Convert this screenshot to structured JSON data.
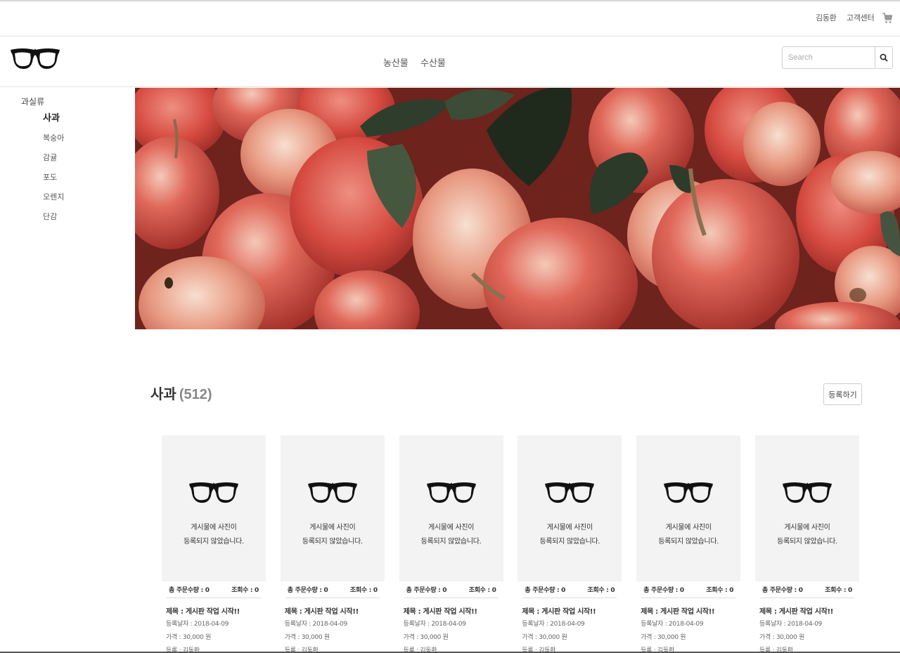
{
  "util_bar": {
    "user_name": "김동환",
    "customer_center": "고객센터",
    "cart_icon": "cart-icon"
  },
  "header": {
    "logo_icon": "glasses-logo-icon",
    "nav": [
      "농산물",
      "수산물"
    ],
    "search": {
      "placeholder": "Search",
      "value": "",
      "button_icon": "search-icon"
    }
  },
  "sidebar": {
    "category": "과실류",
    "items": [
      {
        "label": "사과",
        "active": true
      },
      {
        "label": "복숭아",
        "active": false
      },
      {
        "label": "감귤",
        "active": false
      },
      {
        "label": "포도",
        "active": false
      },
      {
        "label": "오렌지",
        "active": false
      },
      {
        "label": "단감",
        "active": false
      }
    ]
  },
  "banner": {
    "content": "apples-photo"
  },
  "section": {
    "title": "사과",
    "count": "(512)",
    "register_button": "등록하기"
  },
  "products": [
    {
      "msg_line1": "게시물에 사진이",
      "msg_line2": "등록되지 않았습니다.",
      "orders": "총 주문수량 : 0",
      "views": "조회수 : 0",
      "title": "제목 : 게시판 작업 시작!!",
      "date": "등록날자 : 2018-04-09",
      "price": "가격 : 30,000 원",
      "author": "등록 : 김동환"
    },
    {
      "msg_line1": "게시물에 사진이",
      "msg_line2": "등록되지 않았습니다.",
      "orders": "총 주문수량 : 0",
      "views": "조회수 : 0",
      "title": "제목 : 게시판 작업 시작!!",
      "date": "등록날자 : 2018-04-09",
      "price": "가격 : 30,000 원",
      "author": "등록 : 김동환"
    },
    {
      "msg_line1": "게시물에 사진이",
      "msg_line2": "등록되지 않았습니다.",
      "orders": "총 주문수량 : 0",
      "views": "조회수 : 0",
      "title": "제목 : 게시판 작업 시작!!",
      "date": "등록날자 : 2018-04-09",
      "price": "가격 : 30,000 원",
      "author": "등록 : 김동환"
    },
    {
      "msg_line1": "게시물에 사진이",
      "msg_line2": "등록되지 않았습니다.",
      "orders": "총 주문수량 : 0",
      "views": "조회수 : 0",
      "title": "제목 : 게시판 작업 시작!!",
      "date": "등록날자 : 2018-04-09",
      "price": "가격 : 30,000 원",
      "author": "등록 : 김동환"
    },
    {
      "msg_line1": "게시물에 사진이",
      "msg_line2": "등록되지 않았습니다.",
      "orders": "총 주문수량 : 0",
      "views": "조회수 : 0",
      "title": "제목 : 게시판 작업 시작!!",
      "date": "등록날자 : 2018-04-09",
      "price": "가격 : 30,000 원",
      "author": "등록 : 김동환"
    },
    {
      "msg_line1": "게시물에 사진이",
      "msg_line2": "등록되지 않았습니다.",
      "orders": "총 주문수량 : 0",
      "views": "조회수 : 0",
      "title": "제목 : 게시판 작업 시작!!",
      "date": "등록날자 : 2018-04-09",
      "price": "가격 : 30,000 원",
      "author": "등록 : 김동환"
    }
  ]
}
